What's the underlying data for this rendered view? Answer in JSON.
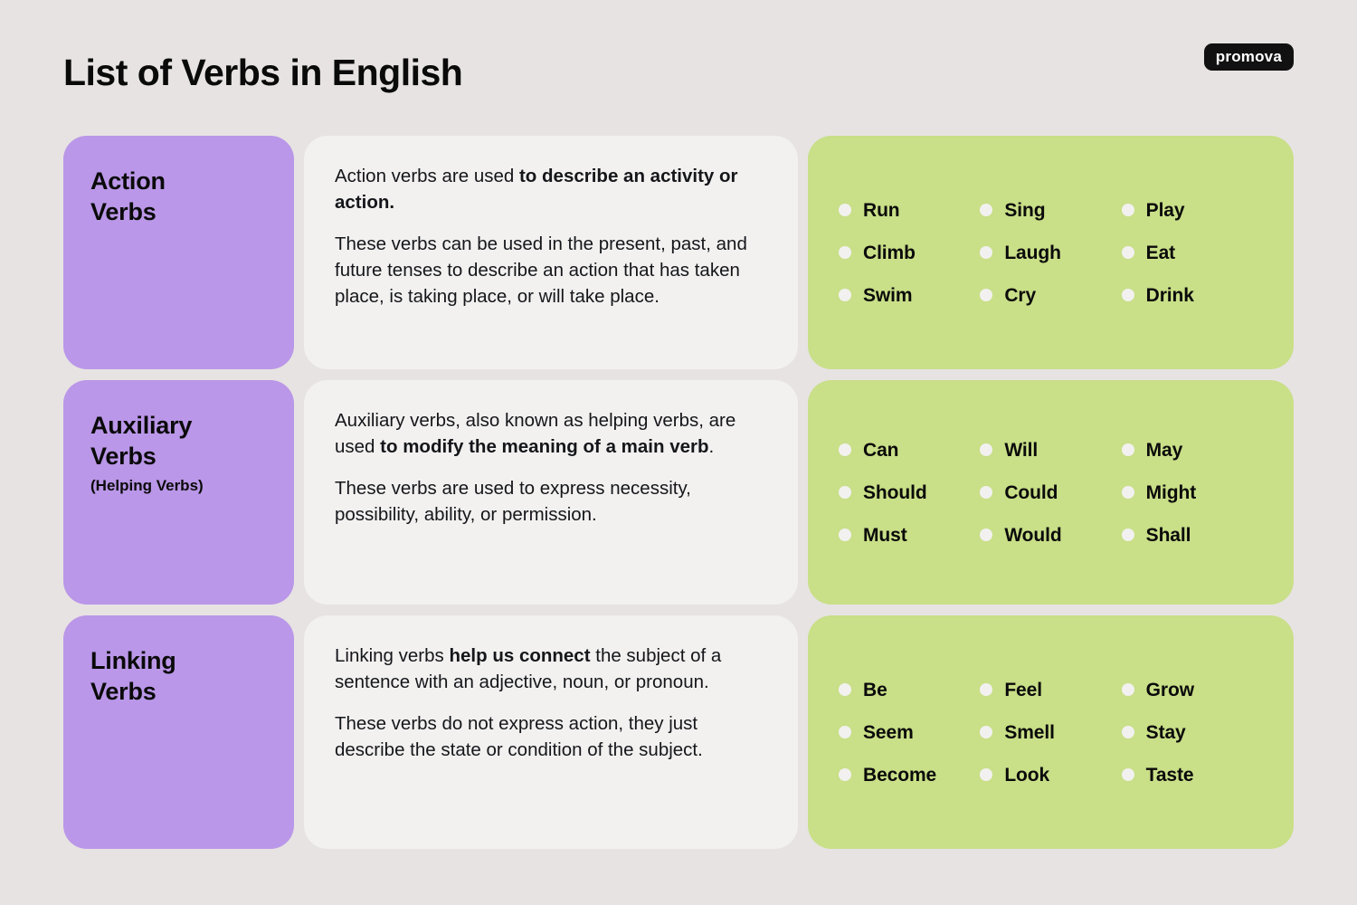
{
  "header": {
    "title": "List of Verbs in English",
    "logo": "promova"
  },
  "colors": {
    "background": "#E7E3E2",
    "category_card": "#BA97E8",
    "description_card": "#F2F1F0",
    "verbs_card": "#C9DF88",
    "bullet": "#F2F1F0",
    "text": "#0A0A0A",
    "logo_background": "#111111",
    "logo_text": "#FFFFFF"
  },
  "rows": [
    {
      "category": {
        "title": "Action\nVerbs",
        "subtitle": ""
      },
      "paragraphs": [
        {
          "lead": "Action verbs are used ",
          "bold": "to describe an activity or action.",
          "tail": ""
        },
        {
          "lead": "These verbs can be used in the present, past, and future tenses to describe an action that has taken place, is taking place, or will take place.",
          "bold": "",
          "tail": ""
        }
      ],
      "verbs": [
        "Run",
        "Sing",
        "Play",
        "Climb",
        "Laugh",
        "Eat",
        "Swim",
        "Cry",
        "Drink"
      ]
    },
    {
      "category": {
        "title": "Auxiliary\nVerbs",
        "subtitle": "(Helping Verbs)"
      },
      "paragraphs": [
        {
          "lead": "Auxiliary verbs, also known as helping verbs, are used ",
          "bold": "to modify the meaning of a main verb",
          "tail": "."
        },
        {
          "lead": "These verbs are used to express necessity, possibility, ability, or permission.",
          "bold": "",
          "tail": ""
        }
      ],
      "verbs": [
        "Can",
        "Will",
        "May",
        "Should",
        "Could",
        "Might",
        "Must",
        "Would",
        "Shall"
      ]
    },
    {
      "category": {
        "title": "Linking\nVerbs",
        "subtitle": ""
      },
      "paragraphs": [
        {
          "lead": "Linking verbs ",
          "bold": "help us connect",
          "tail": " the subject of a sentence with an adjective, noun, or pronoun."
        },
        {
          "lead": "These verbs do not express action, they just describe the state or condition of the subject.",
          "bold": "",
          "tail": ""
        }
      ],
      "verbs": [
        "Be",
        "Feel",
        "Grow",
        "Seem",
        "Smell",
        "Stay",
        "Become",
        "Look",
        "Taste"
      ]
    }
  ]
}
